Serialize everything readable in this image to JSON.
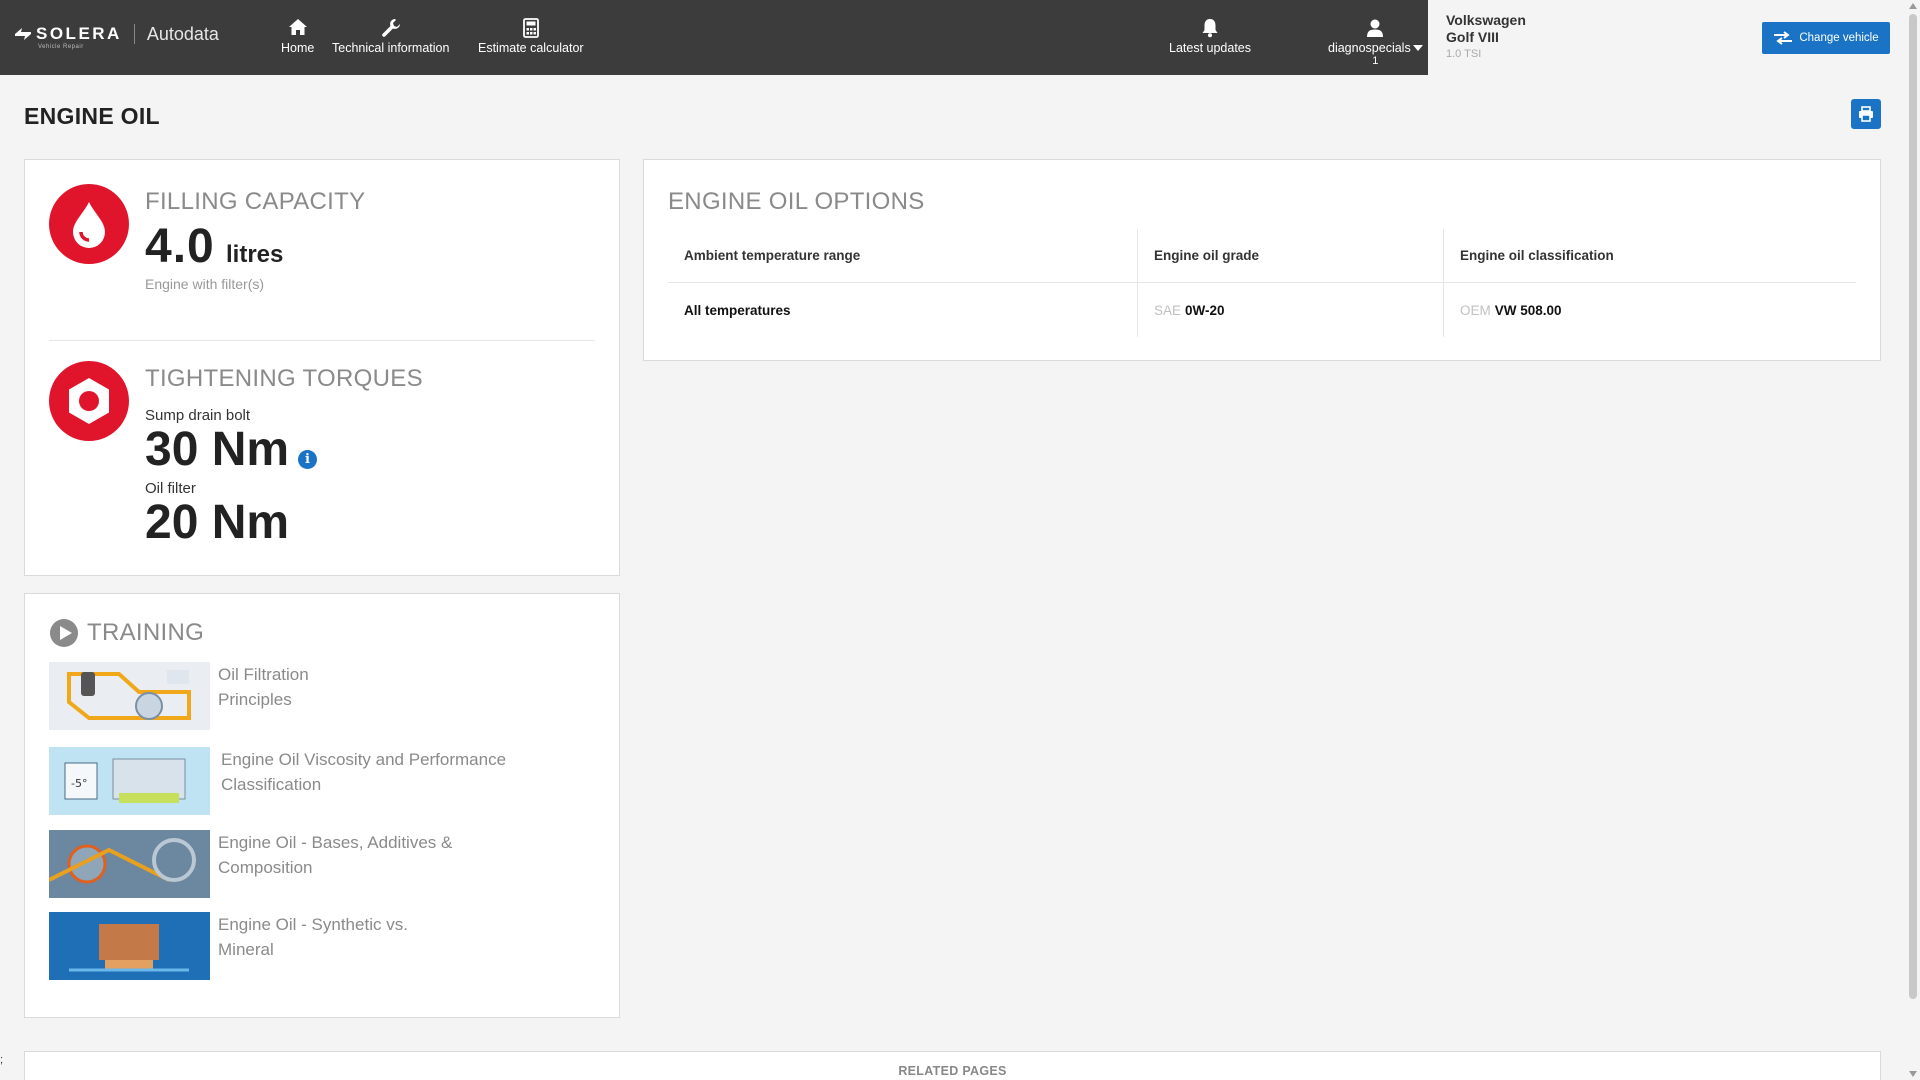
{
  "brand": {
    "logo": "SOLERA",
    "logo_sub": "Vehicle Repair",
    "product": "Autodata"
  },
  "nav": {
    "home": "Home",
    "technical": "Technical information",
    "estimate": "Estimate calculator",
    "updates": "Latest updates",
    "user": "diagnospecials",
    "user_count": "1"
  },
  "vehicle": {
    "make": "Volkswagen",
    "model": "Golf VIII",
    "engine": "1.0 TSI",
    "change_label": "Change vehicle"
  },
  "page": {
    "title": "ENGINE OIL"
  },
  "filling": {
    "title": "FILLING CAPACITY",
    "value": "4.0",
    "unit": "litres",
    "note": "Engine with filter(s)"
  },
  "torques": {
    "title": "TIGHTENING TORQUES",
    "items": [
      {
        "label": "Sump drain bolt",
        "value": "30 Nm"
      },
      {
        "label": "Oil filter",
        "value": "20 Nm"
      }
    ]
  },
  "training": {
    "title": "TRAINING",
    "items": [
      {
        "title": "Oil Filtration Principles",
        "line1": "Oil Filtration",
        "line2": "Principles"
      },
      {
        "title": "Engine Oil Viscosity and Performance Classification",
        "line1": "Engine Oil Viscosity and Performance",
        "line2": "Classification"
      },
      {
        "title": "Engine Oil - Bases, Additives & Composition",
        "line1": "Engine Oil - Bases, Additives &",
        "line2": "Composition"
      },
      {
        "title": "Engine Oil - Synthetic vs. Mineral",
        "line1": "Engine Oil - Synthetic vs.",
        "line2": "Mineral"
      }
    ]
  },
  "options": {
    "title": "ENGINE OIL OPTIONS",
    "headers": [
      "Ambient temperature range",
      "Engine oil grade",
      "Engine oil classification"
    ],
    "rows": [
      {
        "temp": "All temperatures",
        "grade_prefix": "SAE",
        "grade": "0W-20",
        "class_prefix": "OEM",
        "class": "VW 508.00"
      }
    ]
  },
  "related": {
    "label": "RELATED PAGES"
  },
  "colors": {
    "topbar": "#3c3c3c",
    "accent_blue": "#1a73c5",
    "accent_red": "#e0152c"
  }
}
